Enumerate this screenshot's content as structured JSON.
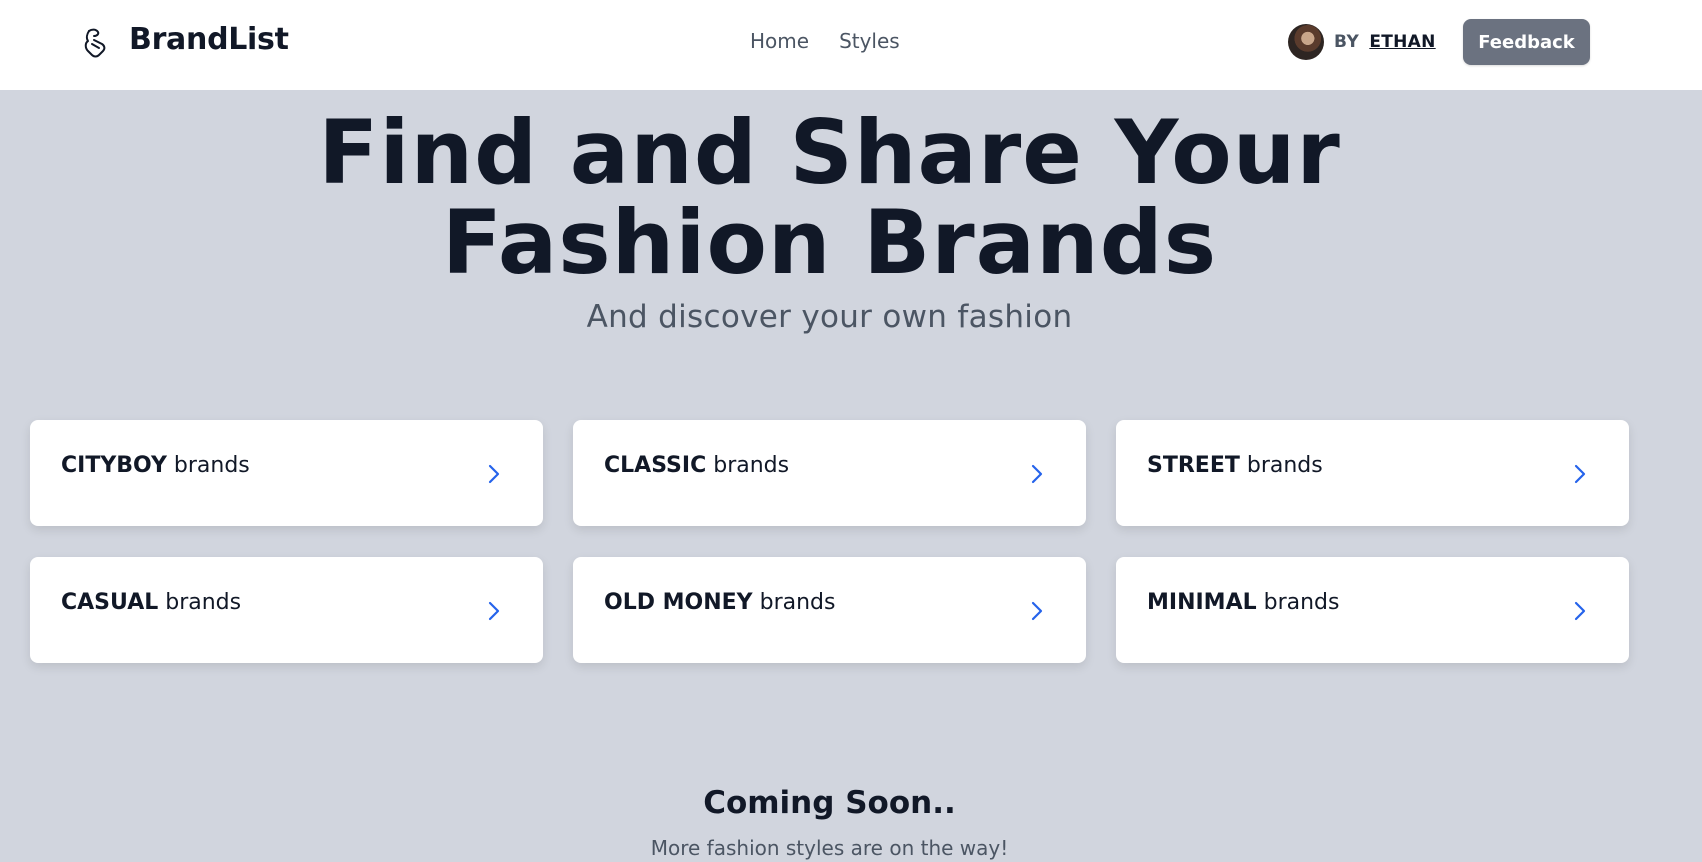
{
  "header": {
    "brand": "BrandList",
    "nav": [
      {
        "label": "Home"
      },
      {
        "label": "Styles"
      }
    ],
    "author_prefix": "BY",
    "author_name": "ETHAN",
    "feedback_label": "Feedback"
  },
  "hero": {
    "title_line1": "Find and Share Your",
    "title_line2": "Fashion Brands",
    "subtitle": "And discover your own fashion"
  },
  "styles": [
    {
      "name": "CITYBOY",
      "suffix": "brands"
    },
    {
      "name": "CLASSIC",
      "suffix": "brands"
    },
    {
      "name": "STREET",
      "suffix": "brands"
    },
    {
      "name": "CASUAL",
      "suffix": "brands"
    },
    {
      "name": "OLD MONEY",
      "suffix": "brands"
    },
    {
      "name": "MINIMAL",
      "suffix": "brands"
    }
  ],
  "coming_soon": {
    "title": "Coming Soon..",
    "subtitle": "More fashion styles are on the way!"
  },
  "icons": {
    "logo": "hanger-logo-icon",
    "card_arrow": "chevron-right-icon"
  },
  "colors": {
    "background": "#d1d5de",
    "text_primary": "#111827",
    "text_secondary": "#4b5563",
    "feedback_button": "#6b7280",
    "chevron": "#2563eb"
  }
}
